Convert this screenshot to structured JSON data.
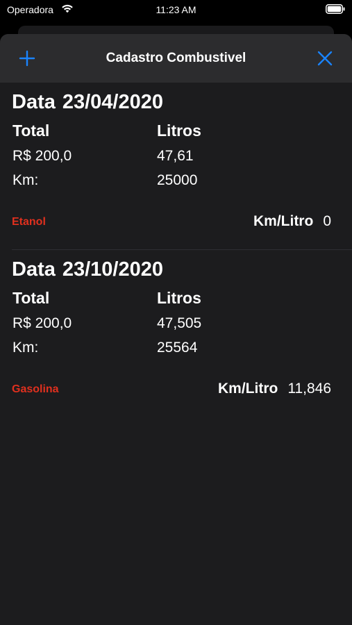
{
  "status_bar": {
    "carrier": "Operadora",
    "time": "11:23 AM",
    "wifi_icon": "wifi-icon",
    "battery_icon": "battery-icon"
  },
  "nav": {
    "title": "Cadastro Combustivel",
    "add_icon": "plus-icon",
    "close_icon": "close-icon",
    "accent_color": "#1a84ff"
  },
  "colors": {
    "background": "#1c1c1e",
    "nav_background": "#2c2c2e",
    "fuel_type": "#e0301e"
  },
  "entries": [
    {
      "date_label": "Data",
      "date": "23/04/2020",
      "total_label": "Total",
      "litros_label": "Litros",
      "total": "R$ 200,0",
      "litros": "47,61",
      "km_label": "Km:",
      "km": "25000",
      "fuel_type": "Etanol",
      "kml_label": "Km/Litro",
      "kml": "0"
    },
    {
      "date_label": "Data",
      "date": "23/10/2020",
      "total_label": "Total",
      "litros_label": "Litros",
      "total": "R$ 200,0",
      "litros": "47,505",
      "km_label": "Km:",
      "km": "25564",
      "fuel_type": "Gasolina",
      "kml_label": "Km/Litro",
      "kml": "11,846"
    }
  ]
}
